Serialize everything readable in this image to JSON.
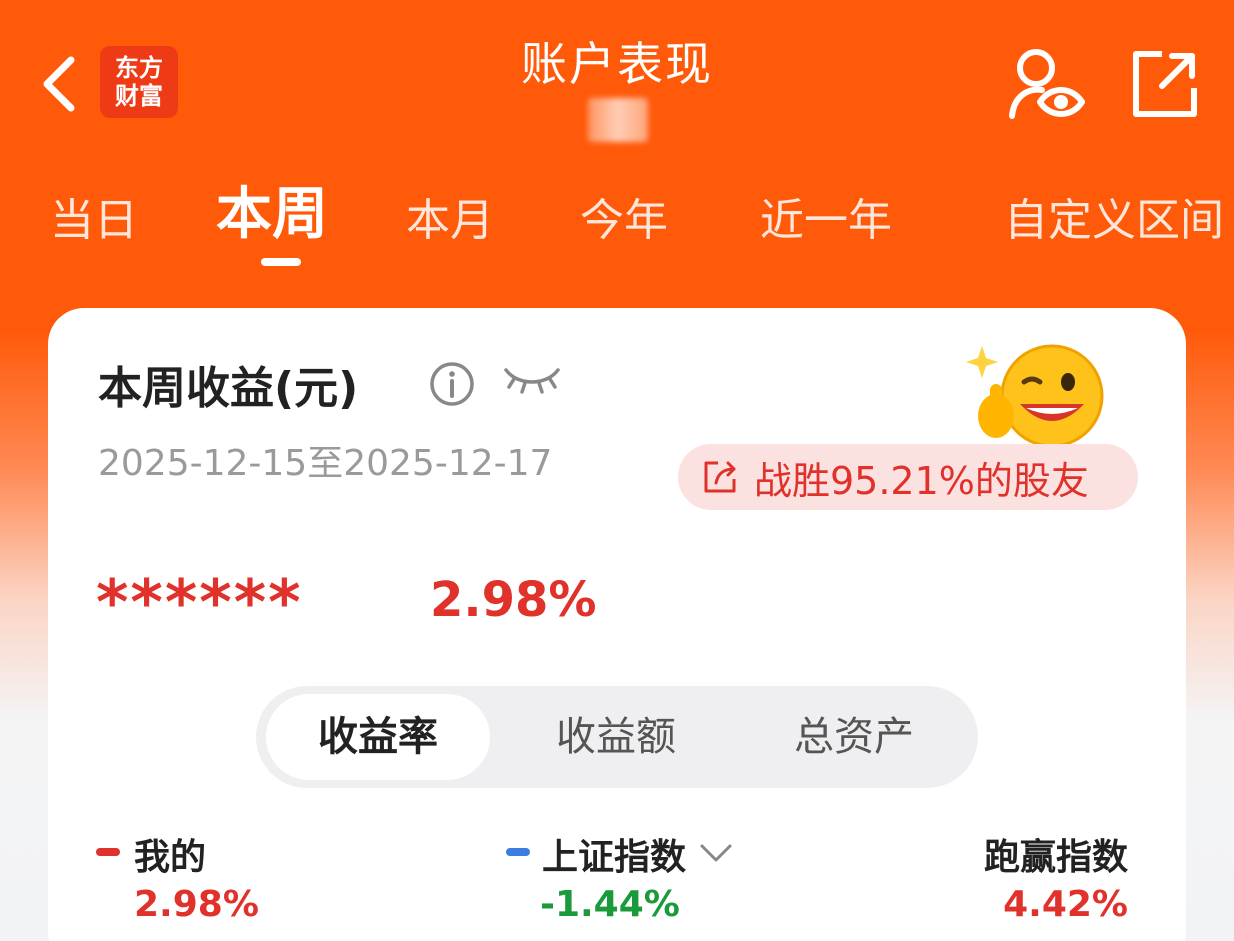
{
  "header": {
    "title": "账户表现",
    "logo_line1": "东方",
    "logo_line2": "财富"
  },
  "tabs": [
    {
      "label": "当日"
    },
    {
      "label": "本周"
    },
    {
      "label": "本月"
    },
    {
      "label": "今年"
    },
    {
      "label": "近一年"
    },
    {
      "label": "自定义区间"
    }
  ],
  "active_tab": "本周",
  "card": {
    "title": "本周收益(元)",
    "date_range": "2025-12-15至2025-12-17",
    "beat_text": "战胜95.21%的股友",
    "masked_amount": "******",
    "return_pct": "2.98%"
  },
  "segment": {
    "items": [
      {
        "label": "收益率"
      },
      {
        "label": "收益额"
      },
      {
        "label": "总资产"
      }
    ],
    "active": "收益率"
  },
  "legend": {
    "mine_label": "我的",
    "mine_value": "2.98%",
    "index_label": "上证指数",
    "index_value": "-1.44%",
    "outperform_label": "跑赢指数",
    "outperform_value": "4.42%"
  },
  "colors": {
    "brand_orange": "#ff5a0a",
    "red": "#e0312a",
    "green": "#1a9a3a",
    "blue": "#3b7de0"
  },
  "icons": [
    "back-arrow-icon",
    "user-eye-icon",
    "share-icon",
    "info-icon",
    "eye-closed-icon",
    "chevron-down-icon"
  ]
}
